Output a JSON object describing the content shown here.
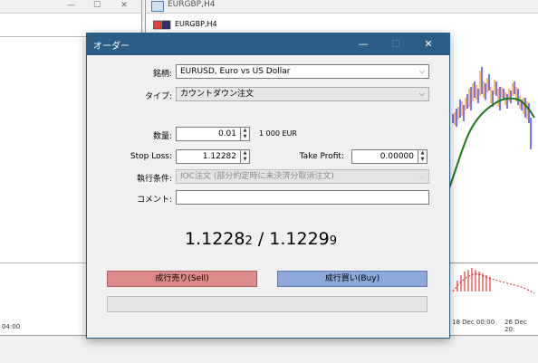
{
  "background": {
    "chart_window_title": "EURGBP,H4",
    "chart_symbol_label": "EURGBP,H4",
    "left_axis_time": "04:00",
    "right_axis_times": [
      "18 Dec 00:00",
      "26 Dec 20:"
    ]
  },
  "dialog": {
    "title": "オーダー",
    "symbol_label": "銘柄:",
    "symbol_value": "EURUSD, Euro vs US Dollar",
    "type_label": "タイプ:",
    "type_value": "カウントダウン注文",
    "volume_label": "数量:",
    "volume_value": "0.01",
    "volume_hint": "1 000 EUR",
    "stoploss_label": "Stop Loss:",
    "stoploss_value": "1.12282",
    "takeprofit_label": "Take Profit:",
    "takeprofit_value": "0.00000",
    "exec_label": "執行条件:",
    "exec_value": "IOC注文 (部分約定時に未決済分取消注文)",
    "comment_label": "コメント:",
    "comment_value": "",
    "bid_main": "1.1228",
    "bid_small": "2",
    "separator": "/",
    "ask_main": "1.1229",
    "ask_small": "9",
    "sell_button": "成行売り(Sell)",
    "buy_button": "成行買い(Buy)"
  }
}
